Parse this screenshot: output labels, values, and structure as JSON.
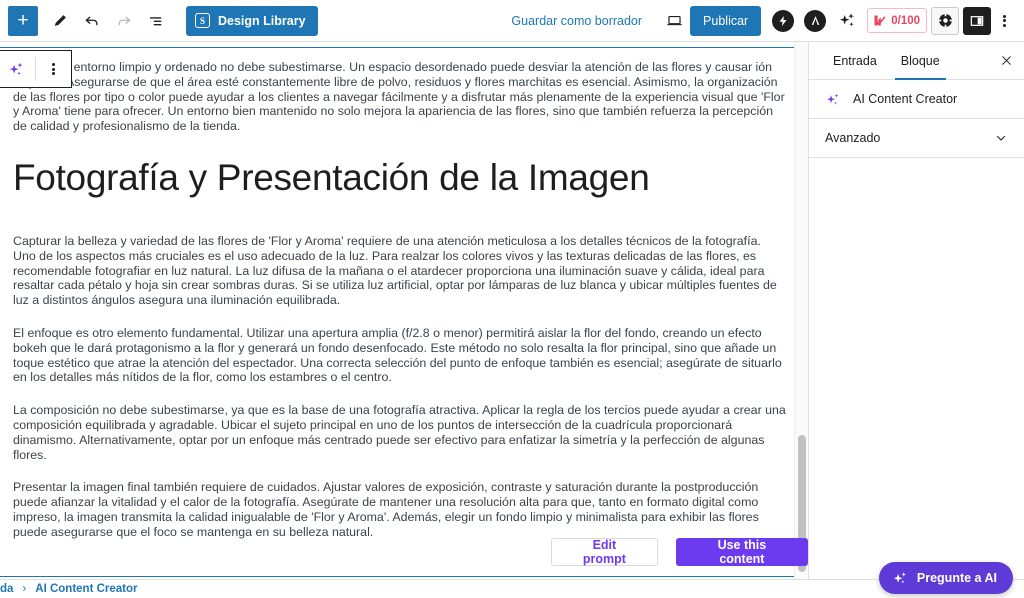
{
  "toolbar": {
    "add_block_label": "+",
    "tools_label": "Herramientas",
    "undo_label": "Deshacer",
    "redo_label": "Rehacer",
    "list_view_label": "Vista de lista",
    "design_library_badge": "S",
    "design_library_label": "Design Library",
    "save_draft_label": "Guardar como borrador",
    "preview_label": "Vista previa",
    "publish_label": "Publicar",
    "seo_score": "0/100",
    "options_label": "Opciones"
  },
  "block_toolbar": {
    "ai_icon_label": "AI",
    "more_options_label": "Más opciones"
  },
  "editor": {
    "paragraph_1": "ncia de un entorno limpio y ordenado no debe subestimarse. Un espacio desordenado puede desviar la atención de las flores y causar ión negativa. Asegurarse de que el área esté constantemente libre de polvo, residuos y flores marchitas es esencial. Asimismo, la organización de las flores por tipo o color puede ayudar a los clientes a navegar fácilmente y a disfrutar más plenamente de la experiencia visual que 'Flor y Aroma' tiene para ofrecer. Un entorno bien mantenido no solo mejora la apariencia de las flores, sino que también refuerza la percepción de calidad y profesionalismo de la tienda.",
    "heading": "Fotografía y Presentación de la Imagen",
    "paragraph_2": "Capturar la belleza y variedad de las flores de 'Flor y Aroma' requiere de una atención meticulosa a los detalles técnicos de la fotografía. Uno de los aspectos más cruciales es el uso adecuado de la luz. Para realzar los colores vivos y las texturas delicadas de las flores, es recomendable fotografiar en luz natural. La luz difusa de la mañana o el atardecer proporciona una iluminación suave y cálida, ideal para resaltar cada pétalo y hoja sin crear sombras duras. Si se utiliza luz artificial, optar por lámparas de luz blanca y ubicar múltiples fuentes de luz a distintos ángulos asegura una iluminación equilibrada.",
    "paragraph_3": "El enfoque es otro elemento fundamental. Utilizar una apertura amplia (f/2.8 o menor) permitirá aislar la flor del fondo, creando un efecto bokeh que le dará protagonismo a la flor y generará un fondo desenfocado. Este método no solo resalta la flor principal, sino que añade un toque estético que atrae la atención del espectador. Una correcta selección del punto de enfoque también es esencial; asegúrate de situarlo en los detalles más nítidos de la flor, como los estambres o el centro.",
    "paragraph_4": "La composición no debe subestimarse, ya que es la base de una fotografía atractiva. Aplicar la regla de los tercios puede ayudar a crear una composición equilibrada y agradable. Ubicar el sujeto principal en uno de los puntos de intersección de la cuadrícula proporcionará dinamismo. Alternativamente, optar por un enfoque más centrado puede ser efectivo para enfatizar la simetría y la perfección de algunas flores.",
    "paragraph_5": "Presentar la imagen final también requiere de cuidados. Ajustar valores de exposición, contraste y saturación durante la postproducción puede afianzar la vitalidad y el calor de la fotografía. Asegúrate de mantener una resolución alta para que, tanto en formato digital como impreso, la imagen transmita la calidad inigualable de 'Flor y Aroma'. Además, elegir un fondo limpio y minimalista para exhibir las flores puede asegurarse que el foco se mantenga en su belleza natural.",
    "edit_prompt_label": "Edit prompt",
    "use_content_label": "Use this content"
  },
  "sidebar": {
    "tab_entry": "Entrada",
    "tab_block": "Bloque",
    "close_label": "✕",
    "block_name": "AI Content Creator",
    "advanced_label": "Avanzado"
  },
  "breadcrumb": {
    "item_1": "da",
    "separator": "›",
    "item_2": "AI Content Creator"
  },
  "ask_ai": {
    "label": "Pregunte a AI"
  },
  "colors": {
    "wp_blue": "#1e77b4",
    "purple": "#6d3bef",
    "ask_ai_purple": "#5e3bd6",
    "seo_red": "#e8455f",
    "text_gray": "#3c434a"
  }
}
